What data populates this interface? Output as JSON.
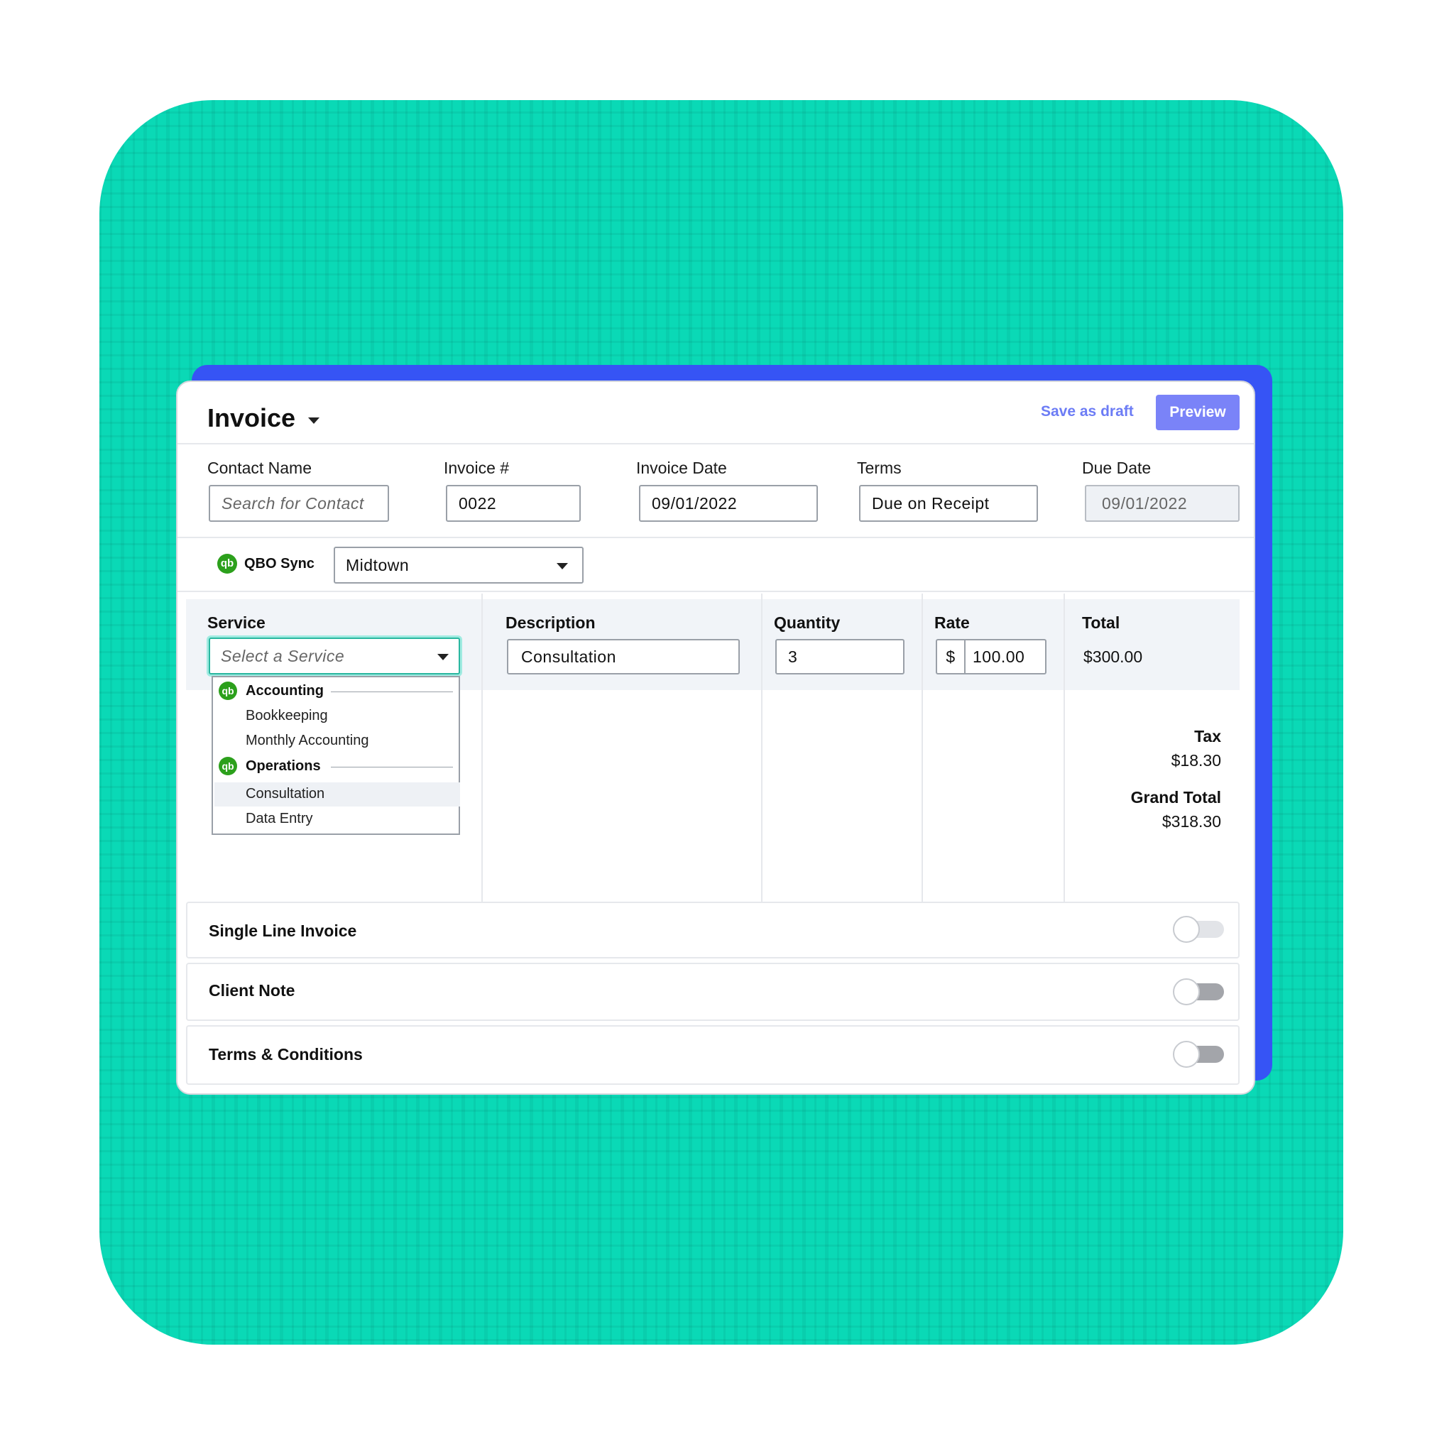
{
  "header": {
    "title": "Invoice",
    "save_draft_label": "Save as draft",
    "preview_label": "Preview"
  },
  "fields": {
    "contact": {
      "label": "Contact Name",
      "placeholder": "Search for Contact"
    },
    "invoice_number": {
      "label": "Invoice #",
      "value": "0022"
    },
    "invoice_date": {
      "label": "Invoice Date",
      "value": "09/01/2022"
    },
    "terms": {
      "label": "Terms",
      "value": "Due on Receipt"
    },
    "due_date": {
      "label": "Due Date",
      "value": "09/01/2022"
    }
  },
  "sync": {
    "qb_icon_text": "qb",
    "label": "QBO Sync",
    "location": "Midtown"
  },
  "table": {
    "headers": {
      "service": "Service",
      "description": "Description",
      "quantity": "Quantity",
      "rate": "Rate",
      "total": "Total"
    },
    "row": {
      "service_placeholder": "Select a Service",
      "description": "Consultation",
      "quantity": "3",
      "currency_symbol": "$",
      "rate": "100.00",
      "total": "$300.00"
    }
  },
  "service_dropdown": {
    "groups": [
      {
        "name": "Accounting",
        "items": [
          "Bookkeeping",
          "Monthly Accounting"
        ]
      },
      {
        "name": "Operations",
        "items": [
          "Consultation",
          "Data Entry"
        ]
      }
    ],
    "highlighted_item": "Consultation"
  },
  "summary": {
    "tax_label": "Tax",
    "tax_value": "$18.30",
    "grand_total_label": "Grand Total",
    "grand_total_value": "$318.30"
  },
  "sections": [
    {
      "label": "Single Line Invoice",
      "enabled": false
    },
    {
      "label": "Client Note",
      "enabled": false
    },
    {
      "label": "Terms & Conditions",
      "enabled": false
    }
  ],
  "colors": {
    "background_teal": "#0ad9b6",
    "accent_blue": "#3654f5",
    "preview_button": "#7a83f8",
    "link_text": "#6c7cf5",
    "quickbooks_green": "#2ca01c"
  }
}
